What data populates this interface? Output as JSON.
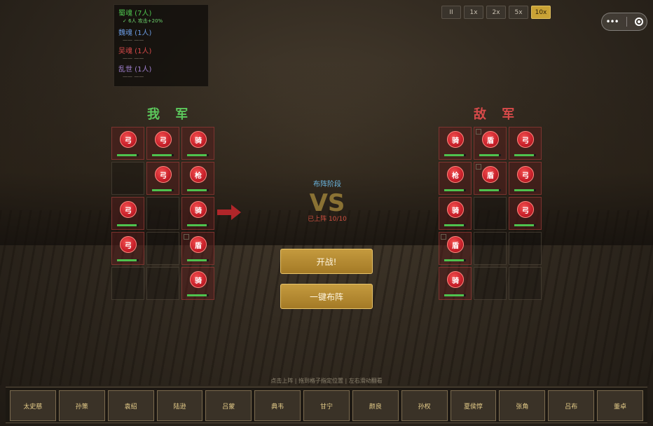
{
  "factions": [
    {
      "name": "蜀魂 (7人)",
      "color": "#4ec24e",
      "sub": "✓ 6人 攻击+20%",
      "active": true
    },
    {
      "name": "魏魂 (1人)",
      "color": "#6a9ae0",
      "sub": "",
      "active": false
    },
    {
      "name": "吴魂 (1人)",
      "color": "#d84a4a",
      "sub": "",
      "active": false
    },
    {
      "name": "乱世 (1人)",
      "color": "#a080d0",
      "sub": "",
      "active": false
    }
  ],
  "speed": {
    "pause": "II",
    "options": [
      "1x",
      "2x",
      "5x",
      "10x"
    ],
    "active": "10x"
  },
  "ours": {
    "title": "我 军",
    "cells": [
      {
        "unit": "弓",
        "hp": 0.9
      },
      {
        "unit": "弓",
        "hp": 0.9
      },
      {
        "unit": "骑",
        "hp": 0.9
      },
      null,
      {
        "unit": "弓",
        "hp": 0.9
      },
      {
        "unit": "枪",
        "hp": 0.9
      },
      {
        "unit": "弓",
        "hp": 0.9
      },
      null,
      {
        "unit": "骑",
        "hp": 0.9
      },
      {
        "unit": "弓",
        "hp": 0.9
      },
      null,
      {
        "unit": "盾",
        "hp": 0.9,
        "lock": true
      },
      null,
      null,
      {
        "unit": "骑",
        "hp": 0.9
      }
    ]
  },
  "enemy": {
    "title": "敌 军",
    "cells": [
      {
        "unit": "骑",
        "hp": 0.9
      },
      {
        "unit": "盾",
        "hp": 0.9,
        "lock": true
      },
      {
        "unit": "弓",
        "hp": 0.9
      },
      {
        "unit": "枪",
        "hp": 0.9
      },
      {
        "unit": "盾",
        "hp": 0.9,
        "lock": true
      },
      {
        "unit": "弓",
        "hp": 0.9
      },
      {
        "unit": "骑",
        "hp": 0.9
      },
      null,
      {
        "unit": "弓",
        "hp": 0.9
      },
      {
        "unit": "盾",
        "hp": 0.9,
        "lock": true
      },
      null,
      null,
      {
        "unit": "骑",
        "hp": 0.9
      },
      null,
      null
    ]
  },
  "center": {
    "phase": "布阵阶段",
    "vs": "VS",
    "deployed": "已上阵 10/10"
  },
  "buttons": {
    "start": "开战!",
    "auto": "一键布阵"
  },
  "hint": "点击上阵 | 拖到格子指定位置 | 左右滑动翻看",
  "roster": [
    "太史慈",
    "孙策",
    "袁绍",
    "陆逊",
    "吕蒙",
    "典韦",
    "甘宁",
    "颜良",
    "孙权",
    "夏侯惇",
    "张角",
    "吕布",
    "董卓"
  ],
  "colors": {
    "accent": "#c9a235",
    "ally": "#5cc85c",
    "enemy": "#d84a4a"
  }
}
